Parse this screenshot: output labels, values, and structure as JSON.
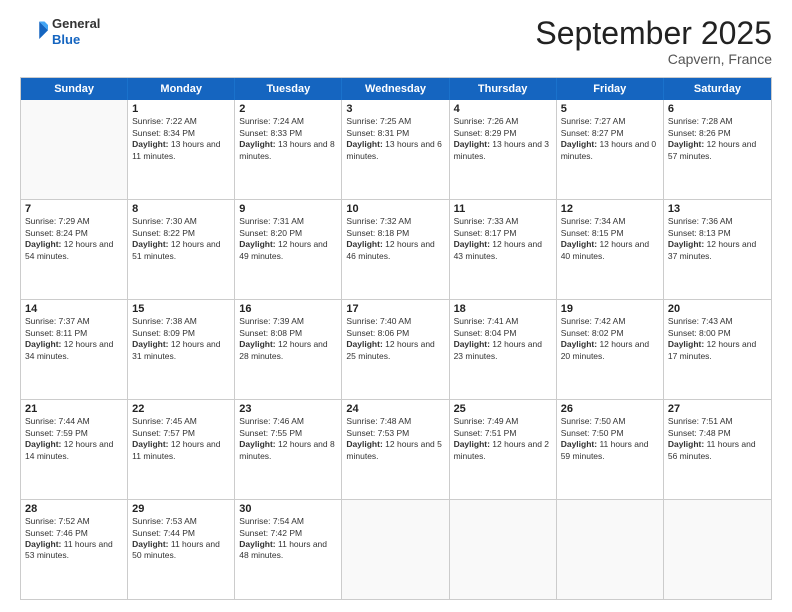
{
  "header": {
    "logo_line1": "General",
    "logo_line2": "Blue",
    "month_title": "September 2025",
    "location": "Capvern, France"
  },
  "days_of_week": [
    "Sunday",
    "Monday",
    "Tuesday",
    "Wednesday",
    "Thursday",
    "Friday",
    "Saturday"
  ],
  "weeks": [
    [
      {
        "day": "",
        "sunrise": "",
        "sunset": "",
        "daylight": ""
      },
      {
        "day": "1",
        "sunrise": "7:22 AM",
        "sunset": "8:34 PM",
        "daylight": "13 hours and 11 minutes."
      },
      {
        "day": "2",
        "sunrise": "7:24 AM",
        "sunset": "8:33 PM",
        "daylight": "13 hours and 8 minutes."
      },
      {
        "day": "3",
        "sunrise": "7:25 AM",
        "sunset": "8:31 PM",
        "daylight": "13 hours and 6 minutes."
      },
      {
        "day": "4",
        "sunrise": "7:26 AM",
        "sunset": "8:29 PM",
        "daylight": "13 hours and 3 minutes."
      },
      {
        "day": "5",
        "sunrise": "7:27 AM",
        "sunset": "8:27 PM",
        "daylight": "13 hours and 0 minutes."
      },
      {
        "day": "6",
        "sunrise": "7:28 AM",
        "sunset": "8:26 PM",
        "daylight": "12 hours and 57 minutes."
      }
    ],
    [
      {
        "day": "7",
        "sunrise": "7:29 AM",
        "sunset": "8:24 PM",
        "daylight": "12 hours and 54 minutes."
      },
      {
        "day": "8",
        "sunrise": "7:30 AM",
        "sunset": "8:22 PM",
        "daylight": "12 hours and 51 minutes."
      },
      {
        "day": "9",
        "sunrise": "7:31 AM",
        "sunset": "8:20 PM",
        "daylight": "12 hours and 49 minutes."
      },
      {
        "day": "10",
        "sunrise": "7:32 AM",
        "sunset": "8:18 PM",
        "daylight": "12 hours and 46 minutes."
      },
      {
        "day": "11",
        "sunrise": "7:33 AM",
        "sunset": "8:17 PM",
        "daylight": "12 hours and 43 minutes."
      },
      {
        "day": "12",
        "sunrise": "7:34 AM",
        "sunset": "8:15 PM",
        "daylight": "12 hours and 40 minutes."
      },
      {
        "day": "13",
        "sunrise": "7:36 AM",
        "sunset": "8:13 PM",
        "daylight": "12 hours and 37 minutes."
      }
    ],
    [
      {
        "day": "14",
        "sunrise": "7:37 AM",
        "sunset": "8:11 PM",
        "daylight": "12 hours and 34 minutes."
      },
      {
        "day": "15",
        "sunrise": "7:38 AM",
        "sunset": "8:09 PM",
        "daylight": "12 hours and 31 minutes."
      },
      {
        "day": "16",
        "sunrise": "7:39 AM",
        "sunset": "8:08 PM",
        "daylight": "12 hours and 28 minutes."
      },
      {
        "day": "17",
        "sunrise": "7:40 AM",
        "sunset": "8:06 PM",
        "daylight": "12 hours and 25 minutes."
      },
      {
        "day": "18",
        "sunrise": "7:41 AM",
        "sunset": "8:04 PM",
        "daylight": "12 hours and 23 minutes."
      },
      {
        "day": "19",
        "sunrise": "7:42 AM",
        "sunset": "8:02 PM",
        "daylight": "12 hours and 20 minutes."
      },
      {
        "day": "20",
        "sunrise": "7:43 AM",
        "sunset": "8:00 PM",
        "daylight": "12 hours and 17 minutes."
      }
    ],
    [
      {
        "day": "21",
        "sunrise": "7:44 AM",
        "sunset": "7:59 PM",
        "daylight": "12 hours and 14 minutes."
      },
      {
        "day": "22",
        "sunrise": "7:45 AM",
        "sunset": "7:57 PM",
        "daylight": "12 hours and 11 minutes."
      },
      {
        "day": "23",
        "sunrise": "7:46 AM",
        "sunset": "7:55 PM",
        "daylight": "12 hours and 8 minutes."
      },
      {
        "day": "24",
        "sunrise": "7:48 AM",
        "sunset": "7:53 PM",
        "daylight": "12 hours and 5 minutes."
      },
      {
        "day": "25",
        "sunrise": "7:49 AM",
        "sunset": "7:51 PM",
        "daylight": "12 hours and 2 minutes."
      },
      {
        "day": "26",
        "sunrise": "7:50 AM",
        "sunset": "7:50 PM",
        "daylight": "11 hours and 59 minutes."
      },
      {
        "day": "27",
        "sunrise": "7:51 AM",
        "sunset": "7:48 PM",
        "daylight": "11 hours and 56 minutes."
      }
    ],
    [
      {
        "day": "28",
        "sunrise": "7:52 AM",
        "sunset": "7:46 PM",
        "daylight": "11 hours and 53 minutes."
      },
      {
        "day": "29",
        "sunrise": "7:53 AM",
        "sunset": "7:44 PM",
        "daylight": "11 hours and 50 minutes."
      },
      {
        "day": "30",
        "sunrise": "7:54 AM",
        "sunset": "7:42 PM",
        "daylight": "11 hours and 48 minutes."
      },
      {
        "day": "",
        "sunrise": "",
        "sunset": "",
        "daylight": ""
      },
      {
        "day": "",
        "sunrise": "",
        "sunset": "",
        "daylight": ""
      },
      {
        "day": "",
        "sunrise": "",
        "sunset": "",
        "daylight": ""
      },
      {
        "day": "",
        "sunrise": "",
        "sunset": "",
        "daylight": ""
      }
    ]
  ]
}
